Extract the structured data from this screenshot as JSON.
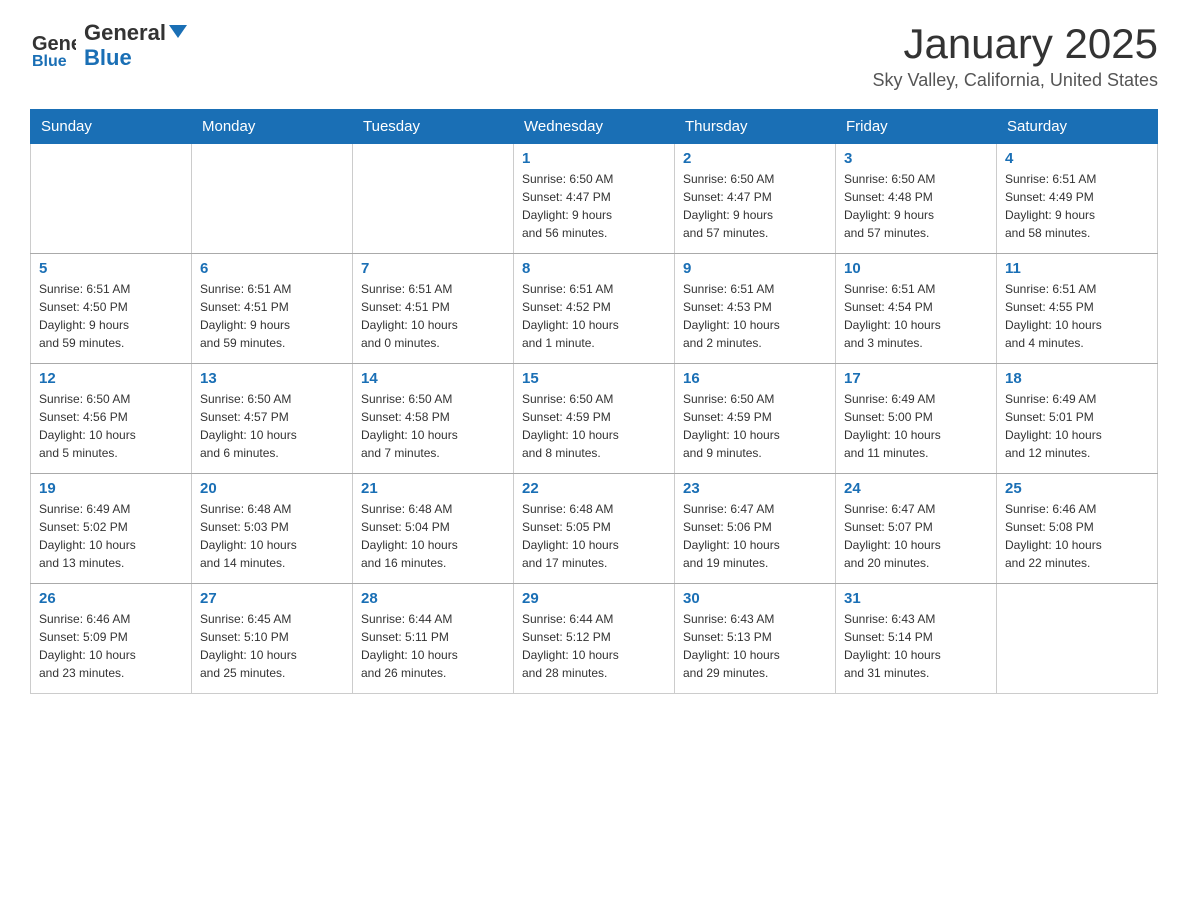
{
  "header": {
    "logo_general": "General",
    "logo_blue": "Blue",
    "month_title": "January 2025",
    "location": "Sky Valley, California, United States"
  },
  "days_of_week": [
    "Sunday",
    "Monday",
    "Tuesday",
    "Wednesday",
    "Thursday",
    "Friday",
    "Saturday"
  ],
  "weeks": [
    [
      {
        "day": "",
        "info": ""
      },
      {
        "day": "",
        "info": ""
      },
      {
        "day": "",
        "info": ""
      },
      {
        "day": "1",
        "info": "Sunrise: 6:50 AM\nSunset: 4:47 PM\nDaylight: 9 hours\nand 56 minutes."
      },
      {
        "day": "2",
        "info": "Sunrise: 6:50 AM\nSunset: 4:47 PM\nDaylight: 9 hours\nand 57 minutes."
      },
      {
        "day": "3",
        "info": "Sunrise: 6:50 AM\nSunset: 4:48 PM\nDaylight: 9 hours\nand 57 minutes."
      },
      {
        "day": "4",
        "info": "Sunrise: 6:51 AM\nSunset: 4:49 PM\nDaylight: 9 hours\nand 58 minutes."
      }
    ],
    [
      {
        "day": "5",
        "info": "Sunrise: 6:51 AM\nSunset: 4:50 PM\nDaylight: 9 hours\nand 59 minutes."
      },
      {
        "day": "6",
        "info": "Sunrise: 6:51 AM\nSunset: 4:51 PM\nDaylight: 9 hours\nand 59 minutes."
      },
      {
        "day": "7",
        "info": "Sunrise: 6:51 AM\nSunset: 4:51 PM\nDaylight: 10 hours\nand 0 minutes."
      },
      {
        "day": "8",
        "info": "Sunrise: 6:51 AM\nSunset: 4:52 PM\nDaylight: 10 hours\nand 1 minute."
      },
      {
        "day": "9",
        "info": "Sunrise: 6:51 AM\nSunset: 4:53 PM\nDaylight: 10 hours\nand 2 minutes."
      },
      {
        "day": "10",
        "info": "Sunrise: 6:51 AM\nSunset: 4:54 PM\nDaylight: 10 hours\nand 3 minutes."
      },
      {
        "day": "11",
        "info": "Sunrise: 6:51 AM\nSunset: 4:55 PM\nDaylight: 10 hours\nand 4 minutes."
      }
    ],
    [
      {
        "day": "12",
        "info": "Sunrise: 6:50 AM\nSunset: 4:56 PM\nDaylight: 10 hours\nand 5 minutes."
      },
      {
        "day": "13",
        "info": "Sunrise: 6:50 AM\nSunset: 4:57 PM\nDaylight: 10 hours\nand 6 minutes."
      },
      {
        "day": "14",
        "info": "Sunrise: 6:50 AM\nSunset: 4:58 PM\nDaylight: 10 hours\nand 7 minutes."
      },
      {
        "day": "15",
        "info": "Sunrise: 6:50 AM\nSunset: 4:59 PM\nDaylight: 10 hours\nand 8 minutes."
      },
      {
        "day": "16",
        "info": "Sunrise: 6:50 AM\nSunset: 4:59 PM\nDaylight: 10 hours\nand 9 minutes."
      },
      {
        "day": "17",
        "info": "Sunrise: 6:49 AM\nSunset: 5:00 PM\nDaylight: 10 hours\nand 11 minutes."
      },
      {
        "day": "18",
        "info": "Sunrise: 6:49 AM\nSunset: 5:01 PM\nDaylight: 10 hours\nand 12 minutes."
      }
    ],
    [
      {
        "day": "19",
        "info": "Sunrise: 6:49 AM\nSunset: 5:02 PM\nDaylight: 10 hours\nand 13 minutes."
      },
      {
        "day": "20",
        "info": "Sunrise: 6:48 AM\nSunset: 5:03 PM\nDaylight: 10 hours\nand 14 minutes."
      },
      {
        "day": "21",
        "info": "Sunrise: 6:48 AM\nSunset: 5:04 PM\nDaylight: 10 hours\nand 16 minutes."
      },
      {
        "day": "22",
        "info": "Sunrise: 6:48 AM\nSunset: 5:05 PM\nDaylight: 10 hours\nand 17 minutes."
      },
      {
        "day": "23",
        "info": "Sunrise: 6:47 AM\nSunset: 5:06 PM\nDaylight: 10 hours\nand 19 minutes."
      },
      {
        "day": "24",
        "info": "Sunrise: 6:47 AM\nSunset: 5:07 PM\nDaylight: 10 hours\nand 20 minutes."
      },
      {
        "day": "25",
        "info": "Sunrise: 6:46 AM\nSunset: 5:08 PM\nDaylight: 10 hours\nand 22 minutes."
      }
    ],
    [
      {
        "day": "26",
        "info": "Sunrise: 6:46 AM\nSunset: 5:09 PM\nDaylight: 10 hours\nand 23 minutes."
      },
      {
        "day": "27",
        "info": "Sunrise: 6:45 AM\nSunset: 5:10 PM\nDaylight: 10 hours\nand 25 minutes."
      },
      {
        "day": "28",
        "info": "Sunrise: 6:44 AM\nSunset: 5:11 PM\nDaylight: 10 hours\nand 26 minutes."
      },
      {
        "day": "29",
        "info": "Sunrise: 6:44 AM\nSunset: 5:12 PM\nDaylight: 10 hours\nand 28 minutes."
      },
      {
        "day": "30",
        "info": "Sunrise: 6:43 AM\nSunset: 5:13 PM\nDaylight: 10 hours\nand 29 minutes."
      },
      {
        "day": "31",
        "info": "Sunrise: 6:43 AM\nSunset: 5:14 PM\nDaylight: 10 hours\nand 31 minutes."
      },
      {
        "day": "",
        "info": ""
      }
    ]
  ]
}
